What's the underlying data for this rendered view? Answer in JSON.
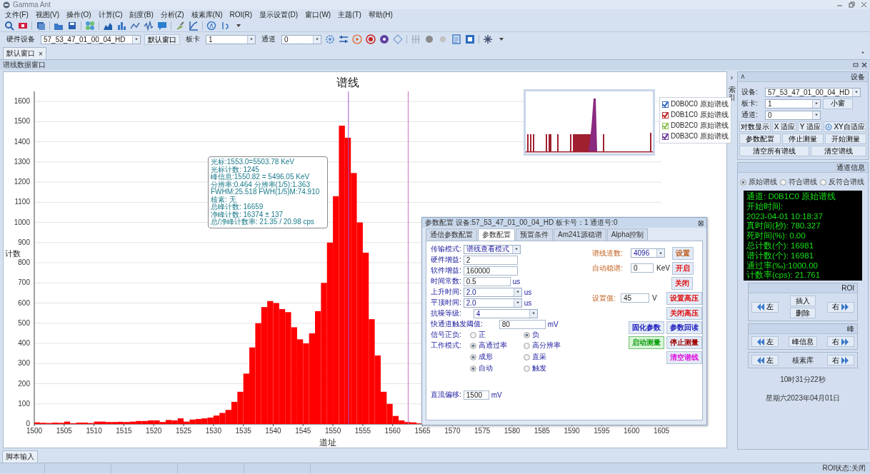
{
  "window": {
    "title": "Gamma Ant"
  },
  "menu": [
    "文件(F)",
    "视图(V)",
    "操作(O)",
    "计算(C)",
    "刻度(B)",
    "分析(Z)",
    "核素库(N)",
    "ROI(R)",
    "显示设置(D)",
    "窗口(W)",
    "主题(T)",
    "帮助(H)"
  ],
  "device_bar": {
    "device_label": "硬件设备",
    "device": "57_53_47_01_00_04_HD",
    "window_button": "默认窗口",
    "board_label": "板卡",
    "board": "1",
    "channel_label": "通道",
    "channel": "0"
  },
  "doc_tabs": [
    {
      "label": "默认窗口",
      "close": "×",
      "selected": true
    }
  ],
  "panel_title": "谱线数据窗口",
  "chart": {
    "chart_data": {
      "type": "bar",
      "title": "谱线",
      "xlabel": "道址",
      "ylabel": "计数",
      "x": [
        1500,
        1501,
        1502,
        1503,
        1504,
        1505,
        1506,
        1507,
        1508,
        1509,
        1510,
        1511,
        1512,
        1513,
        1514,
        1515,
        1516,
        1517,
        1518,
        1519,
        1520,
        1521,
        1522,
        1523,
        1524,
        1525,
        1526,
        1527,
        1528,
        1529,
        1530,
        1531,
        1532,
        1533,
        1534,
        1535,
        1536,
        1537,
        1538,
        1539,
        1540,
        1541,
        1542,
        1543,
        1544,
        1545,
        1546,
        1547,
        1548,
        1549,
        1550,
        1551,
        1552,
        1553,
        1554,
        1555,
        1556,
        1557,
        1558,
        1559,
        1560,
        1561,
        1562,
        1563,
        1564
      ],
      "series": [
        {
          "color": "#ff0000",
          "values": [
            8,
            6,
            5,
            7,
            6,
            12,
            4,
            7,
            7,
            5,
            12,
            12,
            10,
            10,
            11,
            10,
            12,
            15,
            15,
            18,
            18,
            10,
            20,
            18,
            28,
            12,
            22,
            25,
            28,
            32,
            42,
            55,
            70,
            110,
            160,
            250,
            380,
            500,
            580,
            610,
            600,
            570,
            555,
            480,
            420,
            400,
            450,
            560,
            700,
            900,
            1130,
            1480,
            1420,
            1245,
            1000,
            850,
            520,
            340,
            160,
            100,
            40,
            18,
            10,
            8,
            3
          ]
        }
      ],
      "xlim": [
        1500,
        1605
      ],
      "ylim": [
        0,
        1650
      ],
      "xticks": [
        1500,
        1505,
        1510,
        1515,
        1520,
        1525,
        1530,
        1535,
        1540,
        1545,
        1550,
        1555,
        1560,
        1565,
        1570,
        1575,
        1580,
        1585,
        1590,
        1595,
        1600,
        1605
      ],
      "yticks": [
        0,
        100,
        200,
        300,
        400,
        500,
        600,
        700,
        800,
        900,
        1000,
        1100,
        1200,
        1300,
        1400,
        1500,
        1600
      ],
      "grid": true,
      "ref_lines": [
        {
          "axis": "x",
          "value": 1552.6,
          "color": "#9b59d0"
        },
        {
          "axis": "x",
          "value": 1562.6,
          "color": "#d070c0"
        }
      ]
    },
    "tooltip": [
      "光标:1553.0=5503.78 KeV",
      "光标计数: 1245",
      "峰信息:1550.82 = 5496.05 KeV",
      "分辨率:0.464 分辨率(1/5):1.363",
      "FWHM:25.518   FWH(1/5)M:74.910",
      "核素: 无",
      "总峰计数: 16659",
      "净峰计数: 16374 ± 137",
      "总/净峰计数率: 21.35 / 20.98 cps"
    ],
    "legend": [
      {
        "label": "D0B0C0 原始谱线",
        "checked": true,
        "color": "#3a6fc0"
      },
      {
        "label": "D0B1C0 原始谱线",
        "checked": true,
        "color": "#c03030"
      },
      {
        "label": "D0B2C0 原始谱线",
        "checked": true,
        "color": "#8cc050"
      },
      {
        "label": "D0B3C0 原始谱线",
        "checked": true,
        "color": "#7040a0"
      }
    ]
  },
  "dialog": {
    "title": "参数配置 设备:57_53_47_01_00_04_HD 板卡号：1 通道号:0",
    "close": "⊠",
    "tabs": [
      {
        "label": "通信参数配置",
        "selected": false
      },
      {
        "label": "参数配置",
        "selected": true
      },
      {
        "label": "预置条件",
        "selected": false
      },
      {
        "label": "Am241源稳谱",
        "selected": false
      },
      {
        "label": "Alpha控制",
        "selected": false
      }
    ],
    "fields": [
      {
        "kind": "select",
        "label": "传输模式:",
        "value": "谱线查看模式"
      },
      {
        "kind": "input",
        "label": "硬件增益:",
        "value": "2"
      },
      {
        "kind": "input",
        "label": "软件增益:",
        "value": "160000"
      },
      {
        "kind": "input",
        "label": "时间常数:",
        "value": "0.5",
        "unit": "us"
      },
      {
        "kind": "select",
        "label": "上升时间:",
        "value": "2.0",
        "unit": "us"
      },
      {
        "kind": "select",
        "label": "平顶时间:",
        "value": "2.0",
        "unit": "us"
      },
      {
        "kind": "select",
        "label": "抗噪等级:",
        "value": "4"
      },
      {
        "kind": "input",
        "label": "快通道触发阈值:",
        "value": "80",
        "unit": "mV"
      }
    ],
    "radio_groups": [
      {
        "label": "信号正负:",
        "rows": [
          [
            {
              "label": "正",
              "selected": false
            },
            {
              "label": "负",
              "selected": true
            }
          ]
        ]
      },
      {
        "label": "工作模式:",
        "rows": [
          [
            {
              "label": "高通过率",
              "selected": true
            },
            {
              "label": "高分辨率",
              "selected": false
            }
          ],
          [
            {
              "label": "成形",
              "selected": true
            },
            {
              "label": "直采",
              "selected": false
            }
          ],
          [
            {
              "label": "自动",
              "selected": true
            },
            {
              "label": "触发",
              "selected": false
            }
          ]
        ]
      }
    ],
    "offset": {
      "label": "直流偏移:",
      "value": "1500",
      "unit": "mV"
    },
    "channels": {
      "label": "谱线道数:",
      "value": "4096",
      "button": "设置",
      "color": "#c06020"
    },
    "stabilize": {
      "label": "自动稳谱:",
      "value": "0",
      "unit": "KeV",
      "on_button": "开启",
      "off_button": "关闭",
      "color": "#e01010"
    },
    "voltage": {
      "label": "设置值:",
      "value": "45",
      "unit": "V",
      "set_button": "设置高压",
      "off_button": "关闭高压",
      "color": "#e01010"
    },
    "buttons": [
      {
        "label": "固化参数",
        "color": "#2020c0",
        "kind": "plain"
      },
      {
        "label": "参数回读",
        "color": "#2020c0",
        "kind": "plain"
      },
      {
        "label": "启动测量",
        "color": "#10a010",
        "kind": "green"
      },
      {
        "label": "停止测量",
        "color": "#a00000",
        "kind": "plain"
      },
      {
        "label": "清空谱线",
        "color": "#e010e0",
        "kind": "plain"
      }
    ]
  },
  "side": {
    "strip": {
      "arrow": "›",
      "label": "索引"
    },
    "device_group": {
      "collapse": "˄",
      "title": "设备",
      "device_label": "设备:",
      "device": "57_53_47_01_00_04_HD",
      "board_label": "板卡:",
      "board": "1",
      "small_button": "小窗",
      "channel_label": "通道:",
      "channel": "0",
      "buttons": [
        [
          "对数显示",
          "X 适应",
          "Y 适应",
          "XY自适应"
        ],
        [
          "参数配置",
          "停止测量",
          "开始测量"
        ],
        [
          "清空所有谱线",
          "清空谱线"
        ]
      ]
    },
    "info": {
      "title": "通道信息",
      "radios": [
        {
          "label": "原始谱线",
          "selected": true
        },
        {
          "label": "符合谱线",
          "selected": false
        },
        {
          "label": "反符合谱线",
          "selected": false
        }
      ],
      "lines": [
        "通道: D0B1C0 原始谱线",
        "开始时间:",
        "2023-04-01 10:18:37",
        "真时间(秒): 780.327",
        "死时间(%): 0.00",
        "总计数(个): 16981",
        "谱计数(个): 16981",
        "通过率(‰):1000.00",
        "计数率(cps): 21.761"
      ]
    },
    "roi": {
      "title": "ROI",
      "left": "左",
      "insert": "插入",
      "delete": "删除",
      "right": "右"
    },
    "peak": {
      "title": "峰",
      "left": "左",
      "info": "峰信息",
      "right": "右"
    },
    "nuclide": {
      "left": "左",
      "label": "核素库",
      "right": "右"
    },
    "time": "10时31分22秒",
    "date": "星期六2023年04月01日"
  },
  "bottom_tabs": [
    {
      "label": "脚本输入",
      "selected": true
    }
  ],
  "status": "ROI状态:关闭"
}
